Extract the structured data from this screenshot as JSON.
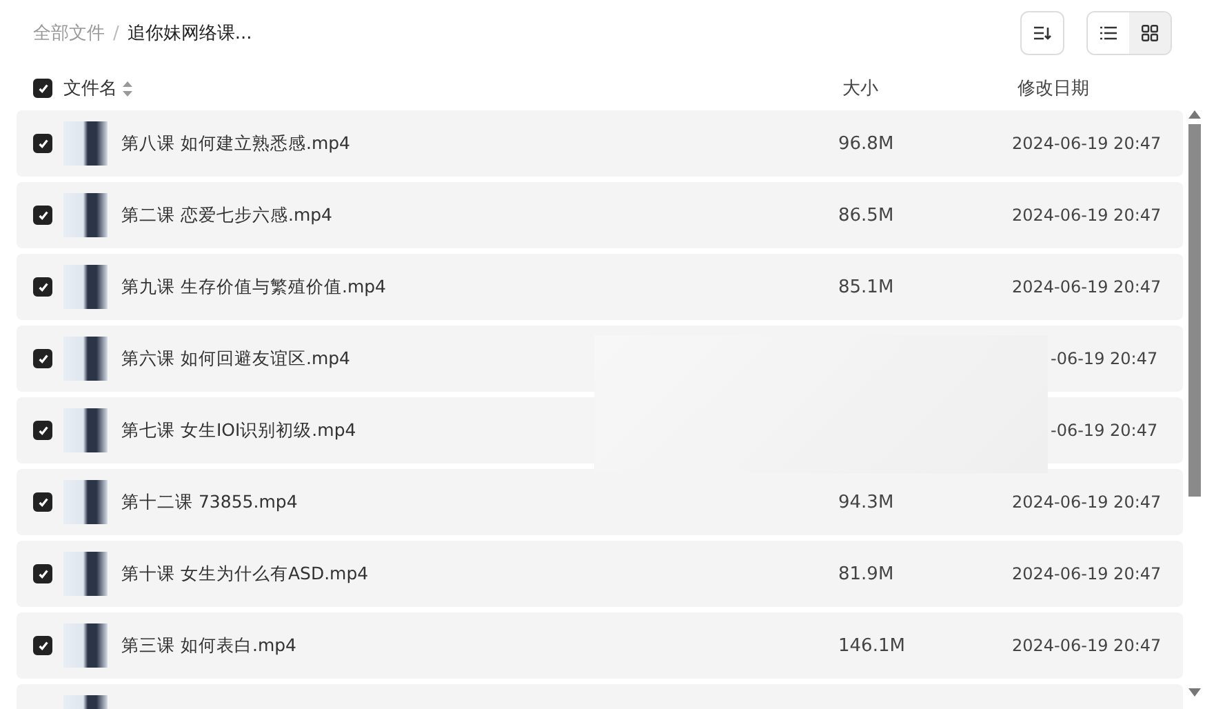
{
  "breadcrumb_separator": "/",
  "breadcrumb": [
    {
      "label": "全部文件",
      "current": false
    },
    {
      "label": "追你妹网络课...",
      "current": true
    }
  ],
  "view_toggle": [
    {
      "kind": "list",
      "selected": false
    },
    {
      "kind": "grid",
      "selected": true
    }
  ],
  "header": {
    "checked": true,
    "name": "文件名",
    "size": "大小",
    "date": "修改日期"
  },
  "files": [
    {
      "checked": true,
      "name": "第八课 如何建立熟悉感.mp4",
      "size": "96.8M",
      "date": "2024-06-19 20:47"
    },
    {
      "checked": true,
      "name": "第二课 恋爱七步六感.mp4",
      "size": "86.5M",
      "date": "2024-06-19 20:47"
    },
    {
      "checked": true,
      "name": "第九课 生存价值与繁殖价值.mp4",
      "size": "85.1M",
      "date": "2024-06-19 20:47"
    },
    {
      "checked": true,
      "name": "第六课 如何回避友谊区.mp4",
      "date": "-06-19 20:47"
    },
    {
      "checked": true,
      "name": "第七课 女生IOI识别初级.mp4",
      "date": "-06-19 20:47"
    },
    {
      "checked": true,
      "name": "第十二课 73855.mp4",
      "size": "94.3M",
      "date": "2024-06-19 20:47"
    },
    {
      "checked": true,
      "name": "第十课 女生为什么有ASD.mp4",
      "size": "81.9M",
      "date": "2024-06-19 20:47"
    },
    {
      "checked": true,
      "name": "第三课 如何表白.mp4",
      "size": "146.1M",
      "date": "2024-06-19 20:47"
    },
    {
      "kind": "cut_off"
    }
  ]
}
